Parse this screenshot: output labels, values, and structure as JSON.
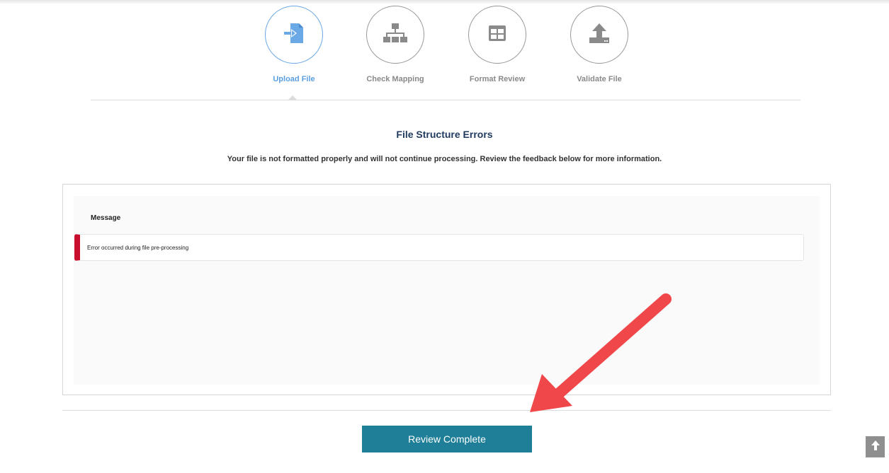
{
  "stepper": {
    "steps": [
      {
        "label": "Upload File",
        "icon": "upload-file-icon",
        "active": true
      },
      {
        "label": "Check Mapping",
        "icon": "sitemap-icon",
        "active": false
      },
      {
        "label": "Format Review",
        "icon": "table-icon",
        "active": false
      },
      {
        "label": "Validate File",
        "icon": "upload-tray-icon",
        "active": false
      }
    ]
  },
  "main": {
    "title": "File Structure Errors",
    "subtitle": "Your file is not formatted properly and will not continue processing. Review the feedback below for more information."
  },
  "errors": {
    "column_header": "Message",
    "rows": [
      {
        "message": "Error occurred during file pre-processing"
      }
    ]
  },
  "actions": {
    "review_complete_label": "Review Complete"
  },
  "colors": {
    "active_step": "#5b9fe0",
    "inactive_step": "#8a8a8a",
    "error_accent": "#c8102e",
    "button_bg": "#1f7f99",
    "annotation_arrow": "#f0474a"
  }
}
